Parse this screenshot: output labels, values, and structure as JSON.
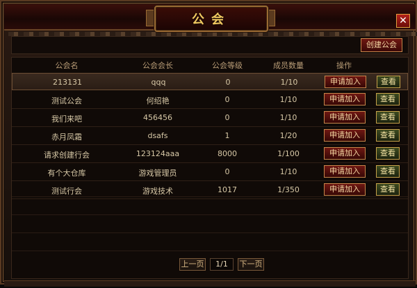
{
  "window": {
    "title": "公会",
    "close_label": "✕"
  },
  "toolbar": {
    "create_label": "创建公会"
  },
  "table": {
    "columns": [
      "公会名",
      "公会会长",
      "公会等级",
      "成员数量",
      "操作"
    ],
    "rows": [
      {
        "name": "213131",
        "leader": "qqq",
        "level": "0",
        "members": "1/10",
        "apply": "申请加入",
        "view": "查看"
      },
      {
        "name": "测试公会",
        "leader": "何绍艳",
        "level": "0",
        "members": "1/10",
        "apply": "申请加入",
        "view": "查看"
      },
      {
        "name": "我们来吧",
        "leader": "456456",
        "level": "0",
        "members": "1/10",
        "apply": "申请加入",
        "view": "查看"
      },
      {
        "name": "赤月凤霜",
        "leader": "dsafs",
        "level": "1",
        "members": "1/20",
        "apply": "申请加入",
        "view": "查看"
      },
      {
        "name": "请求创建行会",
        "leader": "123124aaa",
        "level": "8000",
        "members": "1/100",
        "apply": "申请加入",
        "view": "查看"
      },
      {
        "name": "有个大仓库",
        "leader": "游戏管理员",
        "level": "0",
        "members": "1/10",
        "apply": "申请加入",
        "view": "查看"
      },
      {
        "name": "测试行会",
        "leader": "游戏技术",
        "level": "1017",
        "members": "1/350",
        "apply": "申请加入",
        "view": "查看"
      }
    ],
    "selected_index": 0
  },
  "pager": {
    "prev_label": "上一页",
    "page": "1/1",
    "next_label": "下一页"
  },
  "colors": {
    "title_gold": "#f0c860",
    "apply_red": "#6e1712",
    "view_green": "#3d4a20"
  }
}
